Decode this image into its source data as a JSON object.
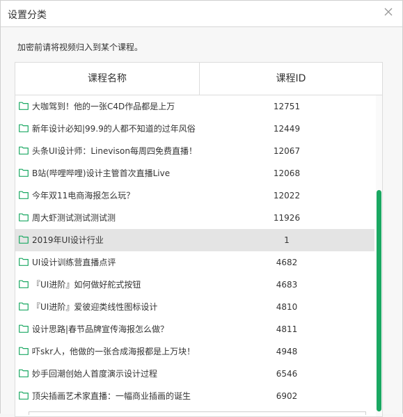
{
  "dialog": {
    "title": "设置分类",
    "description": "加密前请将视频归入到某个课程。"
  },
  "table": {
    "headers": {
      "name": "课程名称",
      "id": "课程ID"
    },
    "rows": [
      {
        "name": "大咖驾到！他的一张C4D作品都是上万",
        "id": "12751"
      },
      {
        "name": "新年设计必知|99.9的人都不知道的过年风俗",
        "id": "12449"
      },
      {
        "name": "头条UI设计师：Linevison每周四免费直播！",
        "id": "12067"
      },
      {
        "name": "B站(哔哩哔哩)设计主管首次直播Live",
        "id": "12068"
      },
      {
        "name": "今年双11电商海报怎么玩？",
        "id": "12022"
      },
      {
        "name": "周大虾测试测试测试测",
        "id": "11926"
      },
      {
        "name": "2019年UI设计行业",
        "id": "1"
      },
      {
        "name": "UI设计训练营直播点评",
        "id": "4682"
      },
      {
        "name": "『UI进阶』如何做好舵式按钮",
        "id": "4683"
      },
      {
        "name": "『UI进阶』爱彼迎类线性图标设计",
        "id": "4810"
      },
      {
        "name": "设计思路|春节品牌宣传海报怎么做？",
        "id": "4811"
      },
      {
        "name": "吓skr人，他做的一张合成海报都是上万块！",
        "id": "4948"
      },
      {
        "name": "妙手回潮创始人首度演示设计过程",
        "id": "6546"
      },
      {
        "name": "顶尖插画艺术家直播：一幅商业插画的诞生",
        "id": "6902"
      }
    ],
    "selected_index": 6
  },
  "icons": {
    "close": "close-icon",
    "row": "folder-icon"
  },
  "colors": {
    "accent": "#1aa862",
    "selected_row": "#e4e4e4",
    "folder": "#1aa862"
  }
}
